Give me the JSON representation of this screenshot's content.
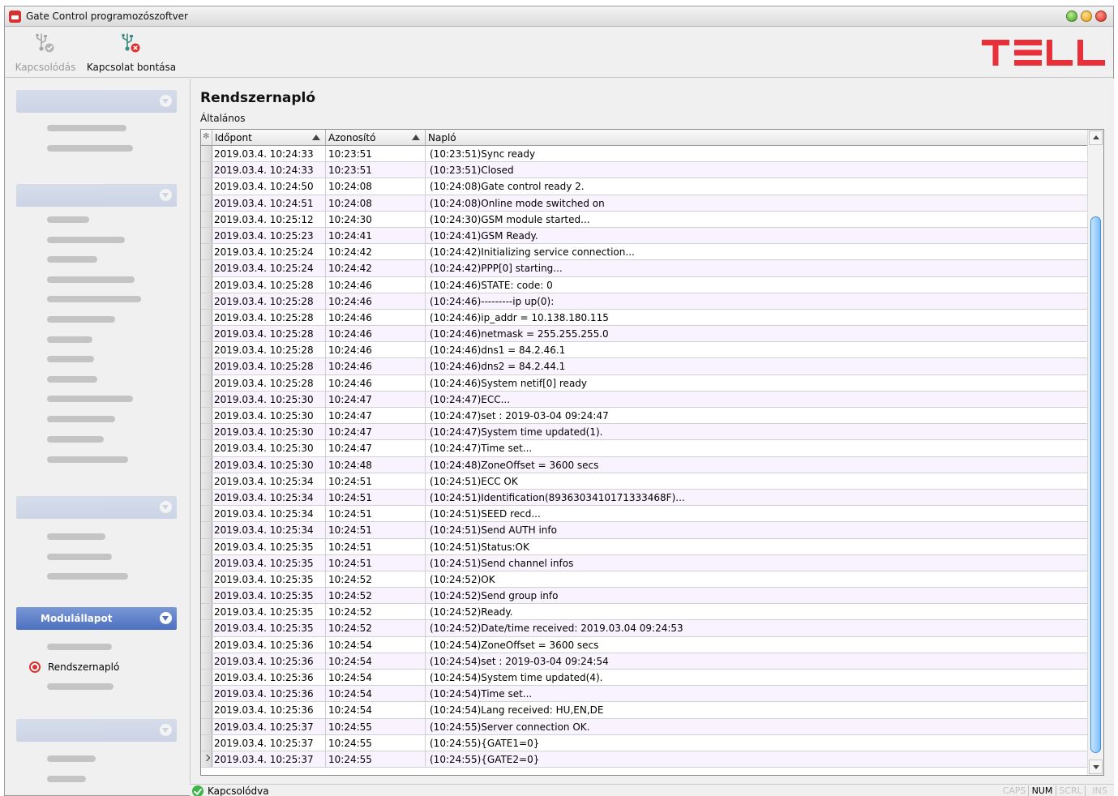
{
  "window": {
    "title": "Gate Control programozószoftver"
  },
  "toolbar": {
    "connect_label": "Kapcsolódás",
    "disconnect_label": "Kapcsolat bontása",
    "brand": "TELL"
  },
  "sidebar": {
    "active_section_label": "Modulállapot",
    "active_item_label": "Rendszernapló"
  },
  "main": {
    "title": "Rendszernapló",
    "subtitle": "Általános"
  },
  "grid": {
    "columns": [
      "Időpont",
      "Azonosító",
      "Napló"
    ],
    "rows": [
      [
        "2019.03.4. 10:24:33",
        "10:23:51",
        "(10:23:51)Sync ready"
      ],
      [
        "2019.03.4. 10:24:33",
        "10:23:51",
        "(10:23:51)Closed"
      ],
      [
        "2019.03.4. 10:24:50",
        "10:24:08",
        "(10:24:08)Gate control ready 2."
      ],
      [
        "2019.03.4. 10:24:51",
        "10:24:08",
        "(10:24:08)Online mode switched on"
      ],
      [
        "2019.03.4. 10:25:12",
        "10:24:30",
        "(10:24:30)GSM module started..."
      ],
      [
        "2019.03.4. 10:25:23",
        "10:24:41",
        "(10:24:41)GSM Ready."
      ],
      [
        "2019.03.4. 10:25:24",
        "10:24:42",
        "(10:24:42)Initializing service connection..."
      ],
      [
        "2019.03.4. 10:25:24",
        "10:24:42",
        "(10:24:42)PPP[0] starting..."
      ],
      [
        "2019.03.4. 10:25:28",
        "10:24:46",
        "(10:24:46)STATE: code: 0"
      ],
      [
        "2019.03.4. 10:25:28",
        "10:24:46",
        "(10:24:46)---------ip up(0):"
      ],
      [
        "2019.03.4. 10:25:28",
        "10:24:46",
        "(10:24:46)ip_addr   = 10.138.180.115"
      ],
      [
        "2019.03.4. 10:25:28",
        "10:24:46",
        "(10:24:46)netmask   = 255.255.255.0"
      ],
      [
        "2019.03.4. 10:25:28",
        "10:24:46",
        "(10:24:46)dns1      = 84.2.46.1"
      ],
      [
        "2019.03.4. 10:25:28",
        "10:24:46",
        "(10:24:46)dns2      = 84.2.44.1"
      ],
      [
        "2019.03.4. 10:25:28",
        "10:24:46",
        "(10:24:46)System netif[0] ready"
      ],
      [
        "2019.03.4. 10:25:30",
        "10:24:47",
        "(10:24:47)ECC..."
      ],
      [
        "2019.03.4. 10:25:30",
        "10:24:47",
        "(10:24:47)set : 2019-03-04 09:24:47"
      ],
      [
        "2019.03.4. 10:25:30",
        "10:24:47",
        "(10:24:47)System time updated(1)."
      ],
      [
        "2019.03.4. 10:25:30",
        "10:24:47",
        "(10:24:47)Time set..."
      ],
      [
        "2019.03.4. 10:25:30",
        "10:24:48",
        "(10:24:48)ZoneOffset = 3600 secs"
      ],
      [
        "2019.03.4. 10:25:34",
        "10:24:51",
        "(10:24:51)ECC OK"
      ],
      [
        "2019.03.4. 10:25:34",
        "10:24:51",
        "(10:24:51)Identification(8936303410171333468F)..."
      ],
      [
        "2019.03.4. 10:25:34",
        "10:24:51",
        "(10:24:51)SEED recd..."
      ],
      [
        "2019.03.4. 10:25:34",
        "10:24:51",
        "(10:24:51)Send AUTH info"
      ],
      [
        "2019.03.4. 10:25:35",
        "10:24:51",
        "(10:24:51)Status:OK"
      ],
      [
        "2019.03.4. 10:25:35",
        "10:24:51",
        "(10:24:51)Send channel infos"
      ],
      [
        "2019.03.4. 10:25:35",
        "10:24:52",
        "(10:24:52)OK"
      ],
      [
        "2019.03.4. 10:25:35",
        "10:24:52",
        "(10:24:52)Send group info"
      ],
      [
        "2019.03.4. 10:25:35",
        "10:24:52",
        "(10:24:52)Ready."
      ],
      [
        "2019.03.4. 10:25:35",
        "10:24:52",
        "(10:24:52)Date/time received: 2019.03.04 09:24:53"
      ],
      [
        "2019.03.4. 10:25:36",
        "10:24:54",
        "(10:24:54)ZoneOffset = 3600 secs"
      ],
      [
        "2019.03.4. 10:25:36",
        "10:24:54",
        "(10:24:54)set : 2019-03-04 09:24:54"
      ],
      [
        "2019.03.4. 10:25:36",
        "10:24:54",
        "(10:24:54)System time updated(4)."
      ],
      [
        "2019.03.4. 10:25:36",
        "10:24:54",
        "(10:24:54)Time set..."
      ],
      [
        "2019.03.4. 10:25:36",
        "10:24:54",
        "(10:24:54)Lang received: HU,EN,DE"
      ],
      [
        "2019.03.4. 10:25:37",
        "10:24:55",
        "(10:24:55)Server connection OK."
      ],
      [
        "2019.03.4. 10:25:37",
        "10:24:55",
        "(10:24:55){GATE1=0}"
      ],
      [
        "2019.03.4. 10:25:37",
        "10:24:55",
        "(10:24:55){GATE2=0}"
      ]
    ],
    "current_row_index": 37
  },
  "statusbar": {
    "status": "Kapcsolódva",
    "keys": [
      {
        "label": "CAPS",
        "active": false
      },
      {
        "label": "NUM",
        "active": true
      },
      {
        "label": "SCRL",
        "active": false
      },
      {
        "label": "INS",
        "active": false
      }
    ]
  },
  "colors": {
    "brand_red": "#e8303a",
    "section_blue": "#4d70c0",
    "scroll_blue": "#3a8ee0",
    "ok_green": "#3cb54a"
  },
  "icons": {
    "connect": "usb-connect-icon",
    "disconnect": "usb-disconnect-icon",
    "status": "check-circle-icon"
  }
}
